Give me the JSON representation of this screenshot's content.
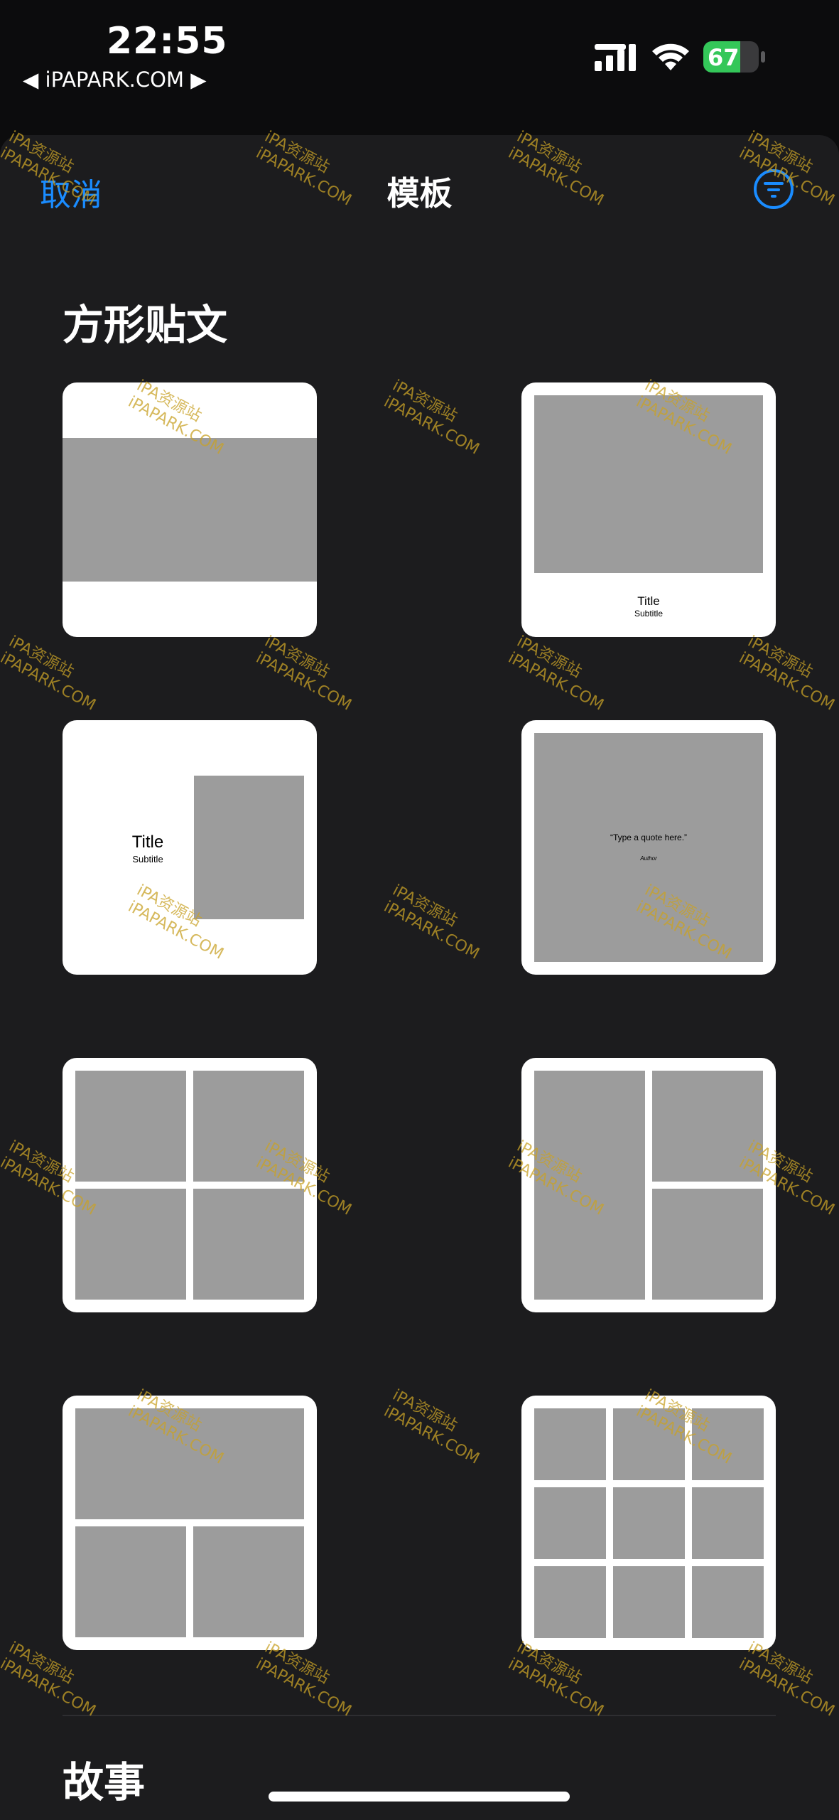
{
  "status_bar": {
    "time": "22:55",
    "back_source": "◀ iPAPARK.COM ▶",
    "battery_level": 67,
    "battery_label": "67"
  },
  "header": {
    "cancel_label": "取消",
    "title": "模板",
    "filter_icon": "filter-lines-icon"
  },
  "sections": [
    {
      "title": "方形贴文",
      "templates": [
        {
          "name": "photo-band"
        },
        {
          "name": "photo-title",
          "title": "Title",
          "subtitle": "Subtitle"
        },
        {
          "name": "title-side-photo",
          "title": "Title",
          "subtitle": "Subtitle"
        },
        {
          "name": "quote",
          "quote": "“Type a quote here.”",
          "author": "Author"
        },
        {
          "name": "grid-2x2"
        },
        {
          "name": "tall-left-two-right"
        },
        {
          "name": "wide-top-two-bottom"
        },
        {
          "name": "grid-3x3"
        }
      ]
    },
    {
      "title": "故事"
    }
  ],
  "watermark": {
    "line1": "iPA资源站",
    "line2": "iPAPARK.COM"
  },
  "colors": {
    "accent": "#1a8cff",
    "sheet_bg": "#1c1c1e",
    "placeholder": "#9c9c9c",
    "battery": "#34c759"
  }
}
